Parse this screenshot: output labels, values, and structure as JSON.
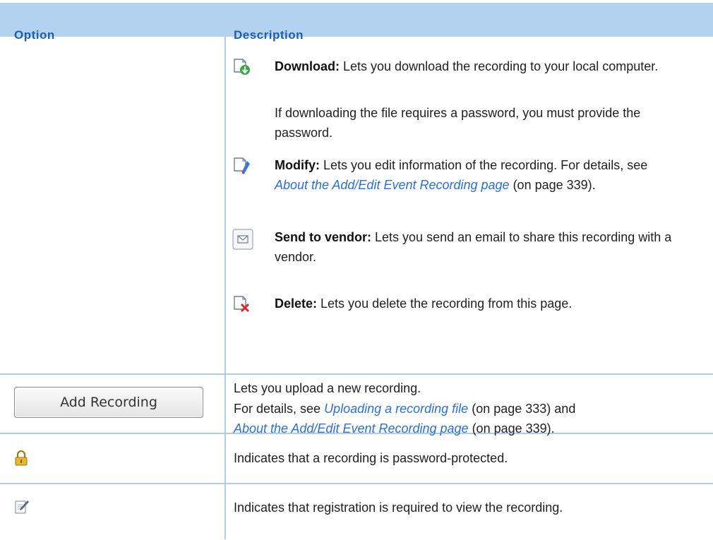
{
  "header": {
    "option": "Option",
    "description": "Description"
  },
  "rows": {
    "download": {
      "title": "Download:",
      "text": " Lets you download the recording to your local computer.",
      "note": "If downloading the file requires a password, you must provide the password.",
      "icon": "download-icon"
    },
    "modify": {
      "title": "Modify:",
      "text": " Lets you edit information of the recording. For details, see ",
      "link": "About the Add/Edit Event Recording page",
      "page": " (on page 339).",
      "icon": "modify-icon"
    },
    "send": {
      "title": "Send to vendor:",
      "text": " Lets you send an email to share this recording with a vendor.",
      "icon": "envelope-icon"
    },
    "delete": {
      "title": "Delete:",
      "text": " Lets you delete the recording from this page.",
      "icon": "delete-icon"
    },
    "add": {
      "button": "Add Recording",
      "text1": "Lets you upload a new recording.",
      "text2_pre": "For details, see ",
      "link1": "Uploading a recording file",
      "text2_mid": " (on page 333) and",
      "link2": "About the Add/Edit Event Recording page",
      "text2_end": " (on page 339)."
    },
    "password": {
      "text": "Indicates that a recording is password-protected.",
      "icon": "lock-icon"
    },
    "registration": {
      "text": "Indicates that registration is required to view the recording.",
      "icon": "registration-icon"
    }
  }
}
